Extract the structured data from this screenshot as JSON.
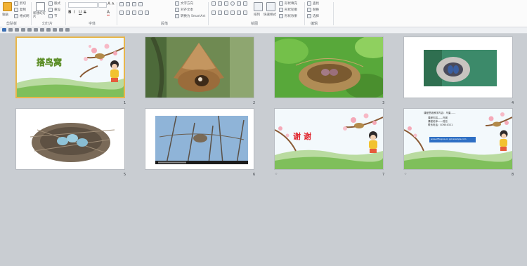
{
  "ribbon": {
    "clipboard": {
      "paste": "粘贴",
      "cut": "剪切",
      "copy": "复制",
      "format_painter": "格式刷",
      "group": "剪贴板"
    },
    "slides": {
      "new_slide": "新建幻灯片",
      "layout": "版式",
      "reset": "重设",
      "section": "节",
      "group": "幻灯片"
    },
    "font": {
      "group": "字体"
    },
    "paragraph": {
      "text_direction": "文字方向",
      "align_text": "对齐文本",
      "smartart": "转换为 SmartArt",
      "group": "段落"
    },
    "drawing": {
      "arrange": "排列",
      "quick_styles": "快速样式",
      "shape_fill": "形状填充",
      "shape_outline": "形状轮廓",
      "shape_effects": "形状效果",
      "group": "绘图"
    },
    "editing": {
      "find": "查找",
      "replace": "替换",
      "select": "选择",
      "group": "编辑"
    }
  },
  "slides": [
    {
      "num": "1",
      "title": "搭鸟窝",
      "selected": true
    },
    {
      "num": "2"
    },
    {
      "num": "3"
    },
    {
      "num": "4"
    },
    {
      "num": "5"
    },
    {
      "num": "6"
    },
    {
      "num": "7",
      "title": "谢谢"
    },
    {
      "num": "8",
      "lines": [
        "课程思政教学内容：鸟巢……",
        "课程内容——鸟窝",
        "课程老师——姓名",
        "联系电话：87654321",
        "www.officeplus.cn   ppt.example.com"
      ]
    }
  ]
}
